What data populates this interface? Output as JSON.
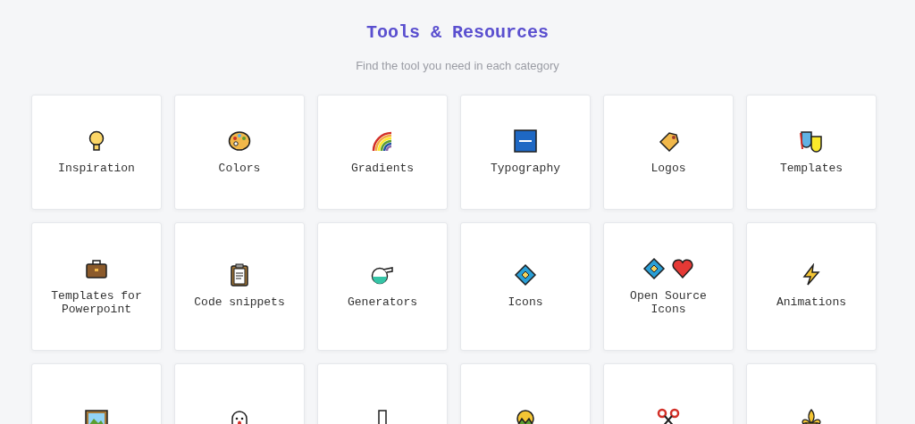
{
  "header": {
    "title": "Tools & Resources",
    "subtitle": "Find the tool you need in each category"
  },
  "cards": [
    {
      "kind": "labeled",
      "label": "Inspiration"
    },
    {
      "kind": "labeled",
      "label": "Colors"
    },
    {
      "kind": "labeled",
      "label": "Gradients"
    },
    {
      "kind": "labeled",
      "label": "Typography"
    },
    {
      "kind": "labeled",
      "label": "Logos"
    },
    {
      "kind": "labeled",
      "label": "Templates"
    },
    {
      "kind": "labeled",
      "label": "Templates for Powerpoint"
    },
    {
      "kind": "labeled",
      "label": "Code snippets"
    },
    {
      "kind": "labeled",
      "label": "Generators"
    },
    {
      "kind": "labeled",
      "label": "Icons"
    },
    {
      "kind": "labeled",
      "label": "Open Source Icons"
    },
    {
      "kind": "labeled",
      "label": "Animations"
    },
    {
      "kind": "icon-only"
    },
    {
      "kind": "icon-only"
    },
    {
      "kind": "icon-only"
    },
    {
      "kind": "icon-only"
    },
    {
      "kind": "icon-only"
    },
    {
      "kind": "icon-only"
    }
  ]
}
